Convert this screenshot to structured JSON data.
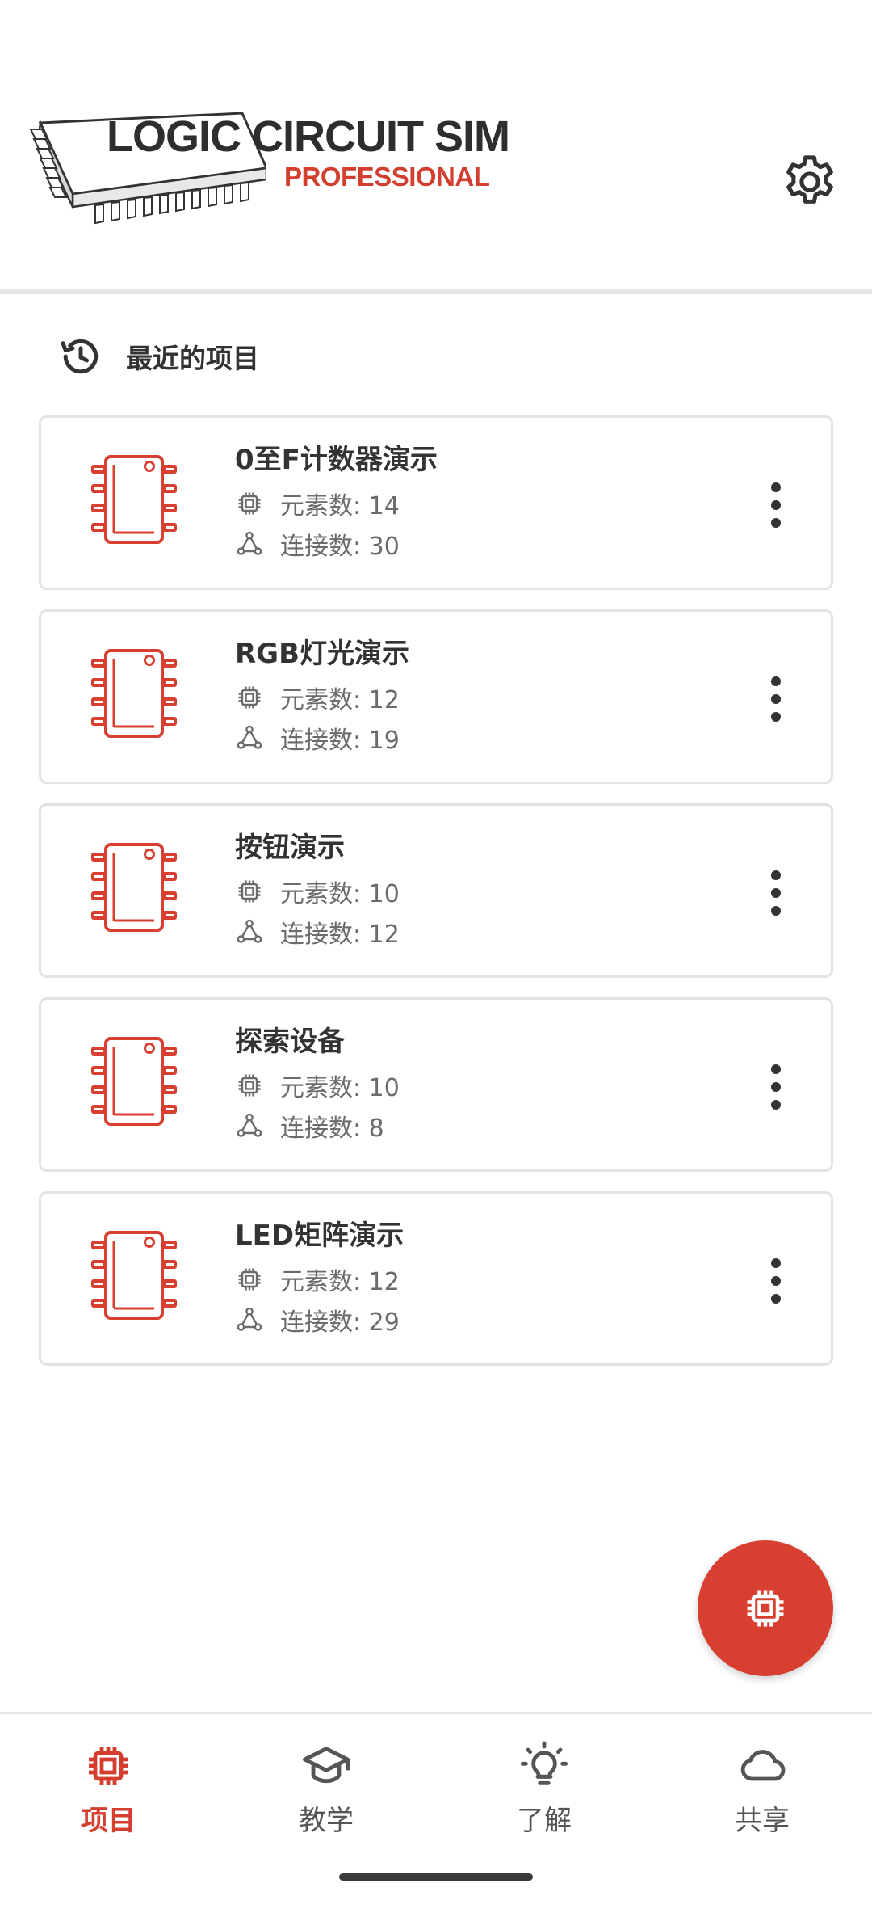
{
  "app": {
    "logo_title": "LOGIC CIRCUIT SIM",
    "logo_subtitle": "PROFESSIONAL",
    "accent_color": "#d33e2f"
  },
  "header": {
    "settings_icon": "gear-icon"
  },
  "recent": {
    "icon": "history-icon",
    "title": "最近的项目"
  },
  "projects": [
    {
      "name": "0至F计数器演示",
      "elements": "元素数: 14",
      "connections": "连接数: 30"
    },
    {
      "name": "RGB灯光演示",
      "elements": "元素数: 12",
      "connections": "连接数: 19"
    },
    {
      "name": "按钮演示",
      "elements": "元素数: 10",
      "connections": "连接数: 12"
    },
    {
      "name": "探索设备",
      "elements": "元素数: 10",
      "connections": "连接数: 8"
    },
    {
      "name": "LED矩阵演示",
      "elements": "元素数: 12",
      "connections": "连接数: 29"
    }
  ],
  "fab": {
    "icon": "chip-icon"
  },
  "bottom_nav": [
    {
      "label": "项目",
      "icon": "chip-icon",
      "active": true
    },
    {
      "label": "教学",
      "icon": "graduation-cap-icon",
      "active": false
    },
    {
      "label": "了解",
      "icon": "lightbulb-icon",
      "active": false
    },
    {
      "label": "共享",
      "icon": "cloud-icon",
      "active": false
    }
  ]
}
